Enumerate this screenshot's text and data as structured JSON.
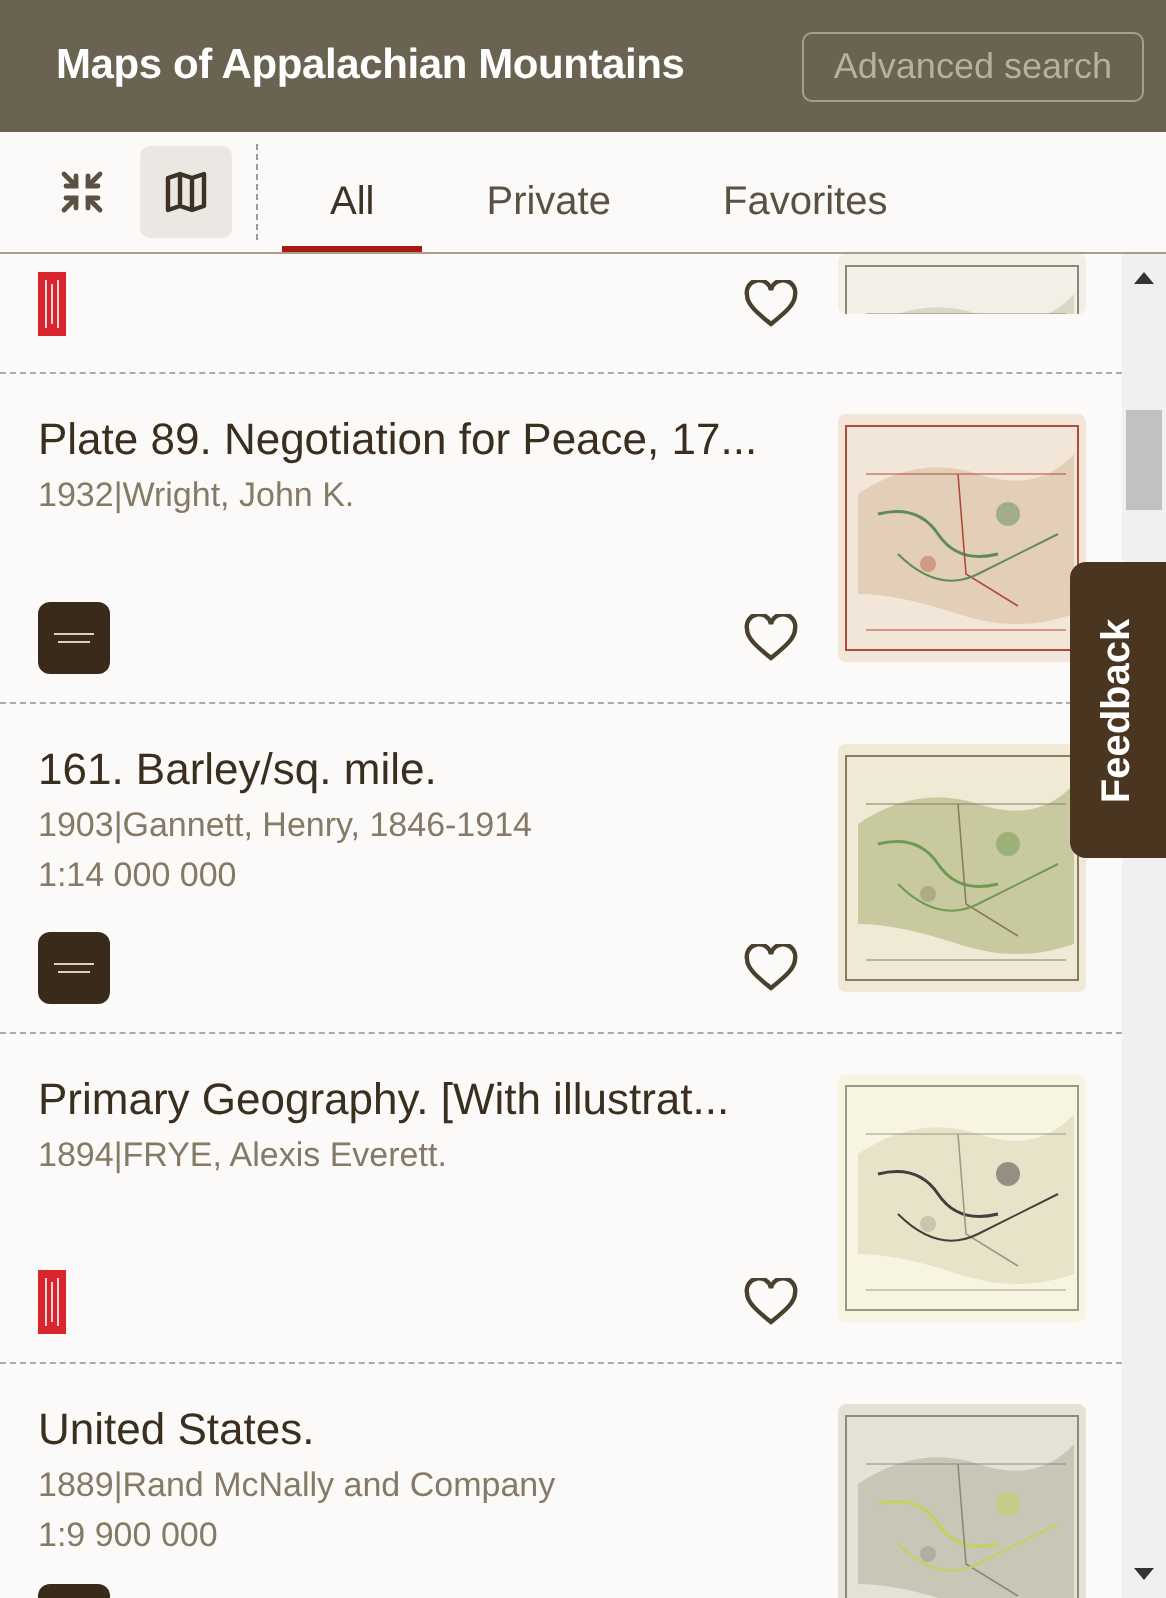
{
  "header": {
    "title": "Maps of Appalachian Mountains",
    "advanced_search": "Advanced search"
  },
  "view_buttons": [
    {
      "kind": "collapse",
      "selected": false
    },
    {
      "kind": "map",
      "selected": true
    }
  ],
  "tabs": [
    {
      "label": "All",
      "selected": true
    },
    {
      "label": "Private",
      "selected": false
    },
    {
      "label": "Favorites",
      "selected": false
    }
  ],
  "items": [
    {
      "logo": {
        "kind": "library"
      },
      "favorite": false
    },
    {
      "title": "Plate 89. Negotiation for Peace, 17...",
      "byline": "1932|Wright, John K.",
      "logo": {
        "kind": "rumsey"
      },
      "favorite": false
    },
    {
      "title": "161. Barley/sq. mile.",
      "byline": "1903|Gannett, Henry, 1846-1914",
      "scale": "1:14 000 000",
      "logo": {
        "kind": "rumsey"
      },
      "favorite": false
    },
    {
      "title": "Primary Geography. [With illustrat...",
      "byline": "1894|FRYE, Alexis Everett.",
      "logo": {
        "kind": "library"
      },
      "favorite": false
    },
    {
      "title": "United States.",
      "byline": "1889|Rand McNally and Company",
      "scale": "1:9 900 000",
      "logo": {
        "kind": "rumsey"
      }
    }
  ],
  "feedback": "Feedback"
}
